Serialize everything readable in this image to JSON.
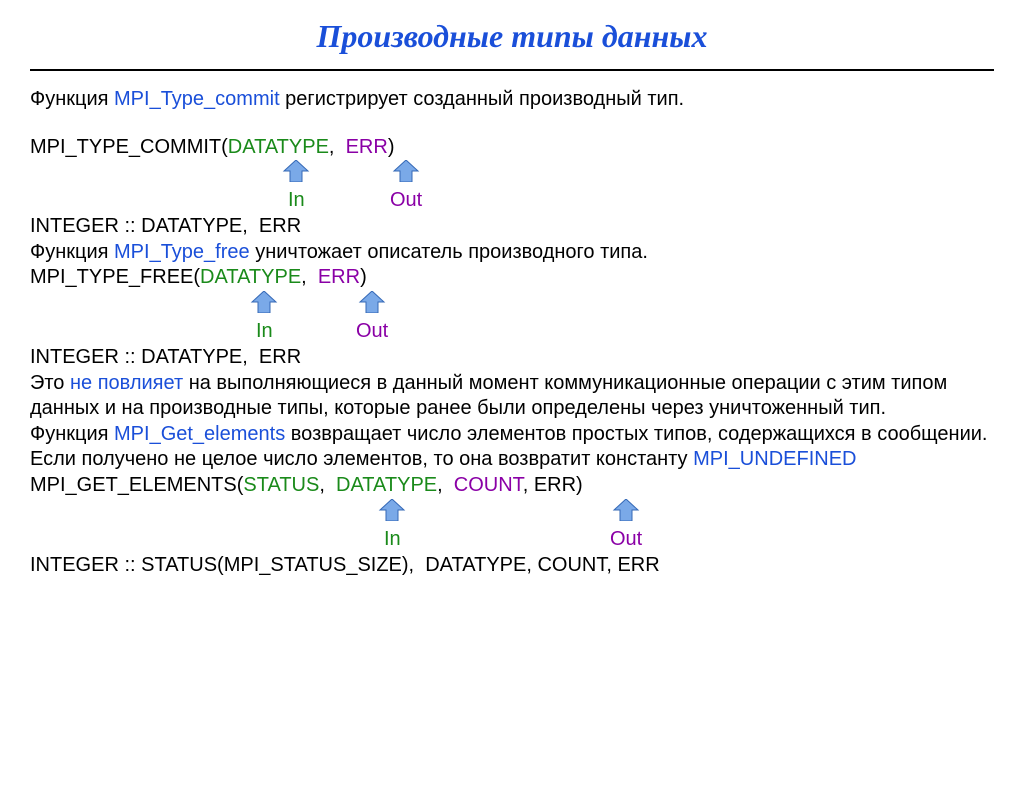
{
  "title": "Производные типы данных",
  "intro_prefix": "Функция ",
  "intro_fn": "MPI_Type_commit",
  "intro_suffix": " регистрирует созданный производный тип.",
  "call1_name": "MPI_TYPE_COMMIT(",
  "call1_arg1": "DATATYPE",
  "comma": ",  ",
  "call1_arg2": "ERR",
  "close": ")",
  "label_in": "In",
  "label_out": "Out",
  "decl1": "INTEGER :: DATATYPE,  ERR",
  "free_prefix": "Функция ",
  "free_fn": "MPI_Type_free",
  "free_suffix": " уничтожает описатель производного типа.",
  "call2_name": "MPI_TYPE_FREE(",
  "call2_arg1": "DATATYPE",
  "call2_arg2": "ERR",
  "decl2": "INTEGER :: DATATYPE,  ERR",
  "p3_prefix": "Это ",
  "p3_blue": "не повлияет",
  "p3_rest": " на выполняющиеся в данный момент коммуникационные операции с этим типом данных и на производные типы, которые ранее были определены через уничтоженный тип.",
  "p4_prefix": "Функция  ",
  "p4_fn": "MPI_Get_elements",
  "p4_suffix": "  возвращает число элементов простых типов, содержащихся в сообщении. Если получено не целое число элементов, то она возвратит константу ",
  "p4_const": "MPI_UNDEFINED",
  "call3_name": "MPI_GET_ELEMENTS(",
  "call3_arg1": "STATUS",
  "call3_arg2": "DATATYPE",
  "call3_arg3": "COUNT",
  "call3_arg4": "ERR",
  "decl3": "INTEGER :: STATUS(MPI_STATUS_SIZE),  DATATYPE, COUNT, ERR"
}
